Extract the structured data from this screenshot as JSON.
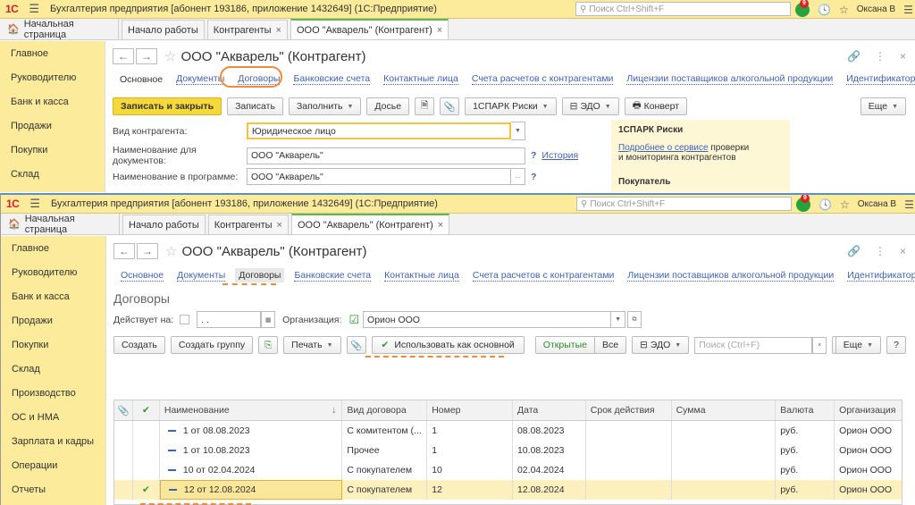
{
  "app": {
    "logo": "1С",
    "title": "Бухгалтерия предприятия [абонент 193186, приложение 1432649] (1С:Предприятие)",
    "search_placeholder": "Поиск Ctrl+Shift+F",
    "notification_count": "9",
    "user": "Оксана В"
  },
  "tabs": {
    "home": "Начальная страница",
    "items": [
      {
        "label": "Начало работы"
      },
      {
        "label": "Контрагенты"
      },
      {
        "label": "ООО \"Акварель\" (Контрагент)"
      }
    ]
  },
  "sidebar": {
    "items": [
      "Главное",
      "Руководителю",
      "Банк и касса",
      "Продажи",
      "Покупки",
      "Склад",
      "Производство",
      "ОС и НМА",
      "Зарплата и кадры",
      "Операции",
      "Отчеты"
    ]
  },
  "form": {
    "title": "ООО \"Акварель\" (Контрагент)",
    "nav_links": {
      "main": "Основное",
      "documents": "Документы",
      "contracts": "Договоры",
      "bank_accounts": "Банковские счета",
      "contacts": "Контактные лица",
      "settlement_accounts": "Счета расчетов с контрагентами",
      "alcohol_licenses": "Лицензии поставщиков алкогольной продукции",
      "site_ids": "Идентификаторы сайта"
    }
  },
  "back": {
    "toolbar": {
      "save_close": "Записать и закрыть",
      "save": "Записать",
      "fill": "Заполнить",
      "dossier": "Досье",
      "spark": "1СПАРК Риски",
      "edo": "ЭДО",
      "envelope": "Конверт",
      "more": "Еще"
    },
    "fields": {
      "kind_label": "Вид контрагента:",
      "kind_value": "Юридическое лицо",
      "docname_label": "Наименование для документов:",
      "docname_value": "ООО \"Акварель\"",
      "history": "История",
      "progname_label": "Наименование в программе:",
      "progname_value": "ООО \"Акварель\""
    },
    "spark_panel": {
      "title": "1СПАРК Риски",
      "link": "Подробнее о сервисе",
      "text1": " проверки",
      "text2": "и мониторинга контрагентов",
      "buyer": "Покупатель"
    }
  },
  "front": {
    "section_title": "Договоры",
    "filters": {
      "active_on_label": "Действует на:",
      "active_on_value": ".  .",
      "org_label": "Организация:",
      "org_value": "Орион ООО",
      "org_checked": true
    },
    "toolbar": {
      "create": "Создать",
      "create_group": "Создать группу",
      "print": "Печать",
      "use_as_main": "Использовать как основной",
      "open": "Открытые",
      "all": "Все",
      "edo": "ЭДО",
      "search_placeholder": "Поиск (Ctrl+F)",
      "more": "Еще",
      "help": "?"
    },
    "table": {
      "columns": [
        "Наименование",
        "Вид договора",
        "Номер",
        "Дата",
        "Срок действия",
        "Сумма",
        "Валюта",
        "Организация"
      ],
      "rows": [
        {
          "name": "1 от 08.08.2023",
          "type": "С комитентом (...",
          "number": "1",
          "date": "08.08.2023",
          "term": "",
          "sum": "",
          "currency": "руб.",
          "org": "Орион ООО",
          "main": false
        },
        {
          "name": "1 от 10.08.2023",
          "type": "Прочее",
          "number": "1",
          "date": "10.08.2023",
          "term": "",
          "sum": "",
          "currency": "руб.",
          "org": "Орион ООО",
          "main": false
        },
        {
          "name": "10 от 02.04.2024",
          "type": "С покупателем",
          "number": "10",
          "date": "02.04.2024",
          "term": "",
          "sum": "",
          "currency": "руб.",
          "org": "Орион ООО",
          "main": false
        },
        {
          "name": "12 от 12.08.2024",
          "type": "С покупателем",
          "number": "12",
          "date": "12.08.2024",
          "term": "",
          "sum": "",
          "currency": "руб.",
          "org": "Орион ООО",
          "main": true
        }
      ]
    }
  },
  "colors": {
    "title_bar": "#fbeb9b",
    "accent_yellow": "#f5d83a",
    "highlight_orange": "#ee8a3a",
    "link_blue": "#4163b3",
    "active_tab_green": "#5cb85c"
  }
}
